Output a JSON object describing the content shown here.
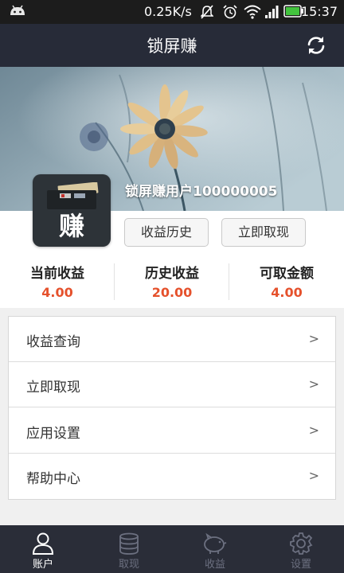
{
  "status_bar": {
    "network_speed": "0.25K/s",
    "time": "15:37",
    "icons": [
      "android-icon",
      "mute-icon",
      "alarm-icon",
      "wifi-icon",
      "signal-icon",
      "battery-icon"
    ]
  },
  "app_bar": {
    "title": "锁屏赚",
    "refresh_icon": "refresh-icon"
  },
  "profile": {
    "logo_char": "赚",
    "username": "锁屏赚用户100000005",
    "history_button": "收益历史",
    "withdraw_button": "立即取现"
  },
  "stats": [
    {
      "label": "当前收益",
      "value": "4.00"
    },
    {
      "label": "历史收益",
      "value": "20.00"
    },
    {
      "label": "可取金额",
      "value": "4.00"
    }
  ],
  "menu": [
    {
      "label": "收益查询",
      "arrow": ">"
    },
    {
      "label": "立即取现",
      "arrow": ">"
    },
    {
      "label": "应用设置",
      "arrow": ">"
    },
    {
      "label": "帮助中心",
      "arrow": ">"
    }
  ],
  "tabs": [
    {
      "label": "账户",
      "icon": "person-icon",
      "active": true
    },
    {
      "label": "取现",
      "icon": "coins-icon",
      "active": false
    },
    {
      "label": "收益",
      "icon": "piggy-bank-icon",
      "active": false
    },
    {
      "label": "设置",
      "icon": "gear-icon",
      "active": false
    }
  ],
  "colors": {
    "app_bar": "#272b38",
    "accent_value": "#e5512c",
    "tab_bar": "#2a2d38"
  }
}
